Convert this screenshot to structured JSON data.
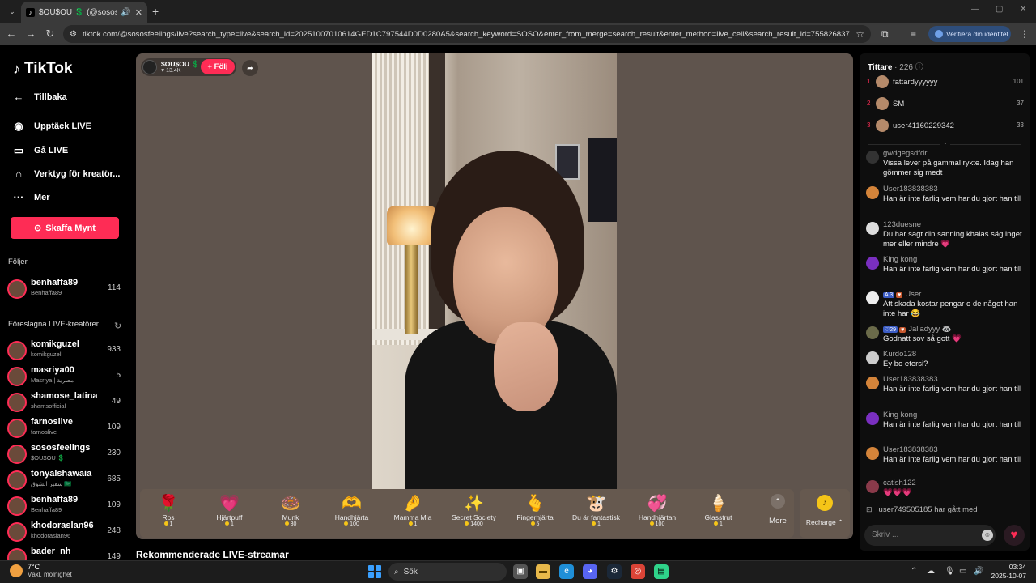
{
  "browser": {
    "tab_title": "$OU$OU 💲 (@sososfeelings",
    "address_site_icon": "site-info-icon",
    "url": "tiktok.com/@sososfeelings/live?search_type=live&search_id=20251007010614GED1C797544D0D0280A5&search_keyword=SOSO&enter_from_merge=search_result&enter_method=live_cell&search_result_id=7558268373327",
    "verify_label": "Verifiera din identitet"
  },
  "sidebar": {
    "logo_text": "TikTok",
    "back_label": "Tillbaka",
    "nav": [
      {
        "label": "Upptäck LIVE",
        "icon": "live-avatar-icon"
      },
      {
        "label": "Gå LIVE",
        "icon": "camera-icon"
      },
      {
        "label": "Verktyg för kreatör...",
        "icon": "home-tools-icon"
      },
      {
        "label": "Mer",
        "icon": "more-dots-icon"
      }
    ],
    "coins_button": "Skaffa Mynt",
    "following_heading": "Följer",
    "following": [
      {
        "name": "benhaffa89",
        "sub": "Benhaffa89",
        "count": "114"
      }
    ],
    "suggested_heading": "Föreslagna LIVE-kreatörer",
    "suggested": [
      {
        "name": "komikguzel",
        "sub": "komikguzel",
        "count": "933"
      },
      {
        "name": "masriya00",
        "sub": "Masriya | مصرية",
        "count": "5"
      },
      {
        "name": "shamose_latina",
        "sub": "shamsofficial",
        "count": "49"
      },
      {
        "name": "farnoslive",
        "sub": "farnoslive",
        "count": "109"
      },
      {
        "name": "sososfeelings",
        "sub": "$OU$OU 💲",
        "count": "230"
      },
      {
        "name": "tonyalshawaia",
        "sub": "سفير الشوق 🇸🇦",
        "count": "685"
      },
      {
        "name": "benhaffa89",
        "sub": "Benhaffa89",
        "count": "109"
      },
      {
        "name": "khodoraslan96",
        "sub": "khodoraslan96",
        "count": "248"
      },
      {
        "name": "bader_nh",
        "sub": "",
        "count": "149"
      }
    ]
  },
  "stream": {
    "host_name": "$OU$OU 💲",
    "host_likes": "♥ 13.4K",
    "follow_label": "+ Följ",
    "gifts": [
      {
        "icon": "🌹",
        "name": "Ros",
        "price": "1"
      },
      {
        "icon": "💗",
        "name": "Hjärtpuff",
        "price": "1"
      },
      {
        "icon": "🍩",
        "name": "Munk",
        "price": "30"
      },
      {
        "icon": "🫶",
        "name": "Handhjärta",
        "price": "100"
      },
      {
        "icon": "🤌",
        "name": "Mamma Mia",
        "price": "1"
      },
      {
        "icon": "✨",
        "name": "Secret Society",
        "price": "1400"
      },
      {
        "icon": "🫰",
        "name": "Fingerhjärta",
        "price": "5"
      },
      {
        "icon": "🐮",
        "name": "Du är fantastisk",
        "price": "1"
      },
      {
        "icon": "💞",
        "name": "Handhjärtan",
        "price": "100"
      },
      {
        "icon": "🍦",
        "name": "Glasstrut",
        "price": "1"
      }
    ],
    "more_label": "More",
    "recharge_label": "Recharge ⌃"
  },
  "recommended_heading": "Rekommenderade LIVE-streamar",
  "panel": {
    "viewers_label": "Tittare",
    "viewers_count": "· 226",
    "top_viewers": [
      {
        "rank": "1",
        "name": "fattardyyyyyy",
        "score": "101"
      },
      {
        "rank": "2",
        "name": "SM",
        "score": "37"
      },
      {
        "rank": "3",
        "name": "user41160229342",
        "score": "33"
      }
    ],
    "chat": [
      {
        "name": "gwdgegsdfdr",
        "text": "Vissa lever på gammal rykte. Idag han gömmer sig medt",
        "badge": "",
        "badge2": ""
      },
      {
        "name": "User183838383",
        "text": "Han är inte farlig vem har du gjort han till",
        "badge": "",
        "badge2": ""
      },
      {
        "name": "123duesne",
        "text": "Du har sagt din sanning khalas säg inget mer eller mindre 💗",
        "badge": "",
        "badge2": ""
      },
      {
        "name": "King kong",
        "text": "Han är inte farlig vem har du gjort han till",
        "badge": "",
        "badge2": ""
      },
      {
        "name": "User",
        "text": "Att skada kostar pengar o de något han inte har 😂",
        "badge": "A 3",
        "badge2": "♥"
      },
      {
        "name": "Jalladyyy 🦝",
        "text": "Godnatt sov så gott 💗",
        "badge": "♡29",
        "badge2": "♥"
      },
      {
        "name": "Kurdo128",
        "text": "Ey bo etersi?",
        "badge": "",
        "badge2": ""
      },
      {
        "name": "User183838383",
        "text": "Han är inte farlig vem har du gjort han till",
        "badge": "",
        "badge2": ""
      },
      {
        "name": "King kong",
        "text": "Han är inte farlig vem har du gjort han till",
        "badge": "",
        "badge2": ""
      },
      {
        "name": "User183838383",
        "text": "Han är inte farlig vem har du gjort han till",
        "badge": "",
        "badge2": ""
      },
      {
        "name": "catish122",
        "text": "💗💗💗",
        "badge": "",
        "badge2": ""
      }
    ],
    "joined_text": "user749505185  har gått med",
    "input_placeholder": "Skriv ..."
  },
  "taskbar": {
    "temp": "7°C",
    "condition": "Växl. molnighet",
    "search_label": "Sök",
    "time": "03:34",
    "date": "2025-10-07"
  },
  "colors": {
    "accent": "#fe2c55",
    "coin": "#f5c518",
    "stage_bg": "#5f544d"
  }
}
